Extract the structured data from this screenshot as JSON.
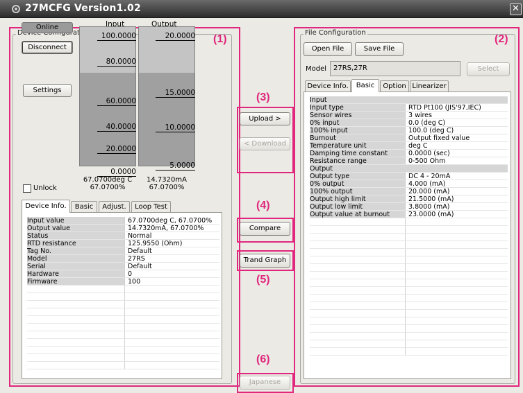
{
  "window": {
    "title": "27MCFG Version1.02",
    "close_glyph": "✕"
  },
  "annotations": [
    "(1)",
    "(2)",
    "(3)",
    "(4)",
    "(5)",
    "(6)"
  ],
  "device_config": {
    "group_label": "Device Configuration",
    "online_label": "Online",
    "disconnect_label": "Disconnect",
    "settings_label": "Settings",
    "unlock_label": "Unlock",
    "input_header": "Input",
    "output_header": "Output",
    "input_ticks": [
      "100.0000",
      "80.0000",
      "60.0000",
      "40.0000",
      "20.0000",
      "0.0000"
    ],
    "output_ticks": [
      "20.0000",
      "15.0000",
      "10.0000",
      "5.0000"
    ],
    "input_value_line1": "67.0700deg C",
    "input_value_line2": "67.0700%",
    "output_value_line1": "14.7320mA",
    "output_value_line2": "67.0700%",
    "input_level_percent": 67.07,
    "output_level_percent": 67.07,
    "tabs": [
      "Device Info.",
      "Basic",
      "Adjust.",
      "Loop Test"
    ],
    "active_tab": 0,
    "info_rows": [
      [
        "Input value",
        "67.0700deg C, 67.0700%"
      ],
      [
        "Output value",
        "14.7320mA, 67.0700%"
      ],
      [
        "Status",
        "Normal"
      ],
      [
        "RTD resistance",
        "125.9550 (Ohm)"
      ],
      [
        "Tag No.",
        "Default"
      ],
      [
        "Model",
        "27RS"
      ],
      [
        "Serial",
        "Default"
      ],
      [
        "Hardware",
        "0"
      ],
      [
        "Firmware",
        "100"
      ]
    ]
  },
  "middle": {
    "upload_label": "Upload >",
    "download_label": "< Download",
    "compare_label": "Compare",
    "trend_label": "Trand Graph",
    "japanese_label": "Japanese"
  },
  "file_config": {
    "group_label": "File Configuration",
    "open_label": "Open File",
    "save_label": "Save File",
    "model_label": "Model",
    "model_value": "27RS,27R",
    "select_label": "Select",
    "tabs": [
      "Device Info.",
      "Basic",
      "Option",
      "Linearizer"
    ],
    "active_tab": 1,
    "rows": [
      {
        "k": "Input",
        "v": "",
        "sec": true
      },
      {
        "k": "Input type",
        "v": "RTD Pt100 (JIS'97,IEC)"
      },
      {
        "k": "Sensor wires",
        "v": "3 wires"
      },
      {
        "k": "0% input",
        "v": "0.0 (deg C)"
      },
      {
        "k": "100% input",
        "v": "100.0 (deg C)"
      },
      {
        "k": "Burnout",
        "v": "Output fixed value"
      },
      {
        "k": "Temperature unit",
        "v": "deg C"
      },
      {
        "k": "Damping time constant",
        "v": "0.0000 (sec)"
      },
      {
        "k": "Resistance range",
        "v": "0-500 Ohm"
      },
      {
        "k": "Output",
        "v": "",
        "sec": true
      },
      {
        "k": "Output type",
        "v": "DC 4 - 20mA"
      },
      {
        "k": "0% output",
        "v": "4.000 (mA)"
      },
      {
        "k": "100% output",
        "v": "20.000 (mA)"
      },
      {
        "k": "Output high limit",
        "v": "21.5000 (mA)"
      },
      {
        "k": "Output low limit",
        "v": "3.8000 (mA)"
      },
      {
        "k": "Output value at burnout",
        "v": "23.0000 (mA)"
      }
    ]
  },
  "colors": {
    "accent_magenta": "#e0267d",
    "client_bg": "#ebeae4"
  }
}
